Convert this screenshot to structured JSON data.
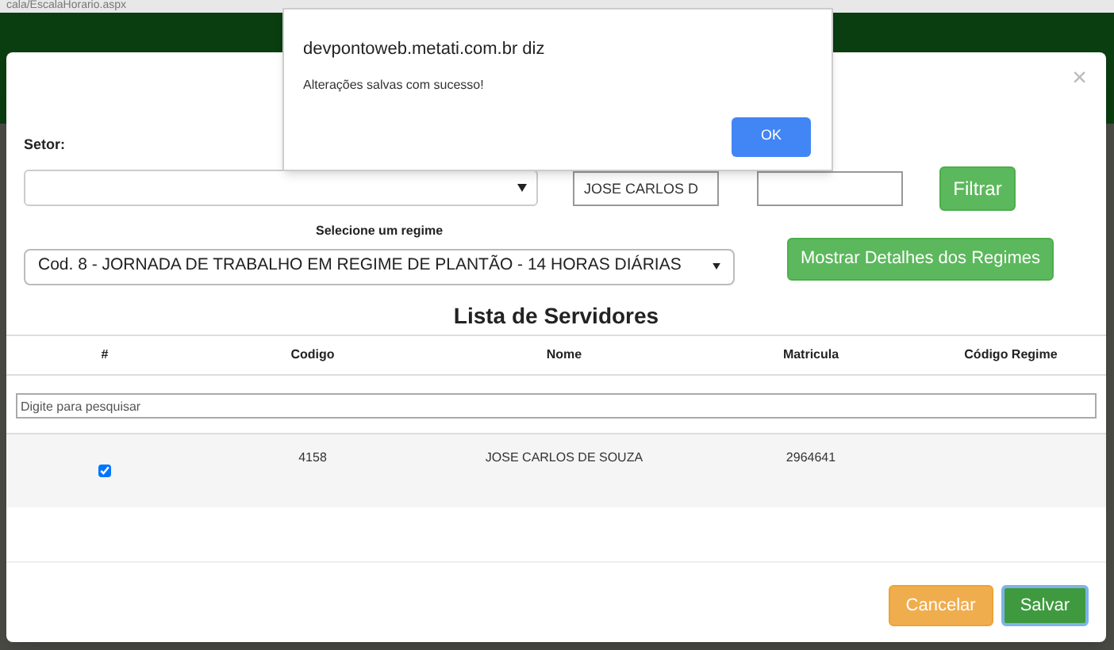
{
  "browser": {
    "address": "cala/EscalaHorario.aspx"
  },
  "alert": {
    "title": "devpontoweb.metati.com.br diz",
    "message": "Alterações salvas com sucesso!",
    "button": "OK"
  },
  "modal": {
    "close": "×",
    "filters": {
      "setor_label": "Setor:",
      "name_value": "JOSE CARLOS D",
      "filter_button": "Filtrar"
    },
    "regime": {
      "label": "Selecione um regime",
      "value": "Cod. 8 - JORNADA DE TRABALHO EM REGIME DE PLANTÃO - 14 HORAS DIÁRIAS",
      "details_button": "Mostrar Detalhes dos Regimes"
    },
    "table": {
      "title": "Lista de Servidores",
      "columns": [
        "#",
        "Codigo",
        "Nome",
        "Matricula",
        "Código Regime"
      ],
      "search_placeholder": "Digite para pesquisar",
      "rows": [
        {
          "checked": true,
          "codigo": "4158",
          "nome": "JOSE CARLOS DE SOUZA",
          "matricula": "2964641",
          "codigo_regime": ""
        }
      ]
    },
    "buttons": {
      "cancel": "Cancelar",
      "save": "Salvar"
    }
  }
}
